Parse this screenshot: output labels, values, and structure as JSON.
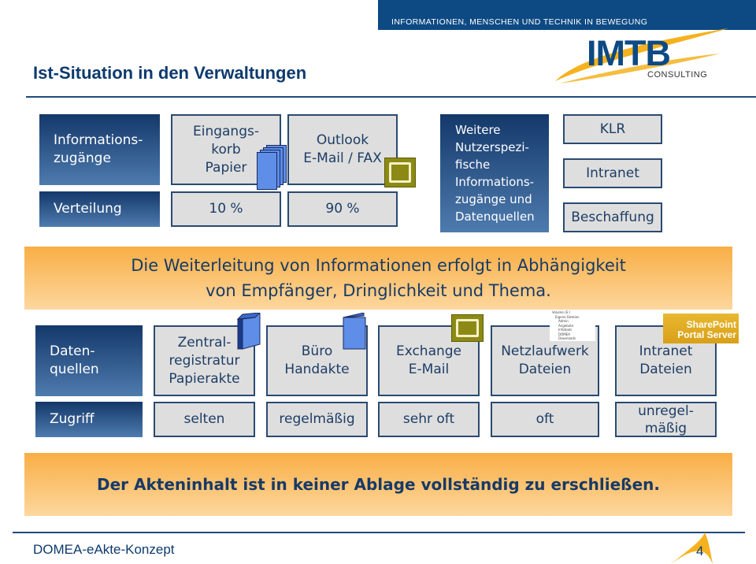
{
  "header": {
    "tagline": "INFORMATIONEN, MENSCHEN UND TECHNIK IN BEWEGUNG",
    "logo_main": "IMTB",
    "logo_sub": "CONSULTING",
    "brand_color": "#0d4a84",
    "accent_color": "#f5b21e"
  },
  "title": "Ist-Situation in den Verwaltungen",
  "top_section": {
    "row_labels": {
      "access": "Informations-\nzugänge",
      "distribution": "Verteilung"
    },
    "sources": [
      {
        "label": "Eingangs-\nkorb\nPapier",
        "share": "10 %",
        "icon": "paper-stack-icon"
      },
      {
        "label": "Outlook\nE-Mail / FAX",
        "share": "90 %",
        "icon": "outlook-mail-icon"
      }
    ],
    "further": "Weitere\nNutzerspezi-\nfische\nInformations-\nzugänge und\nDatenquellen",
    "further_items": [
      "KLR",
      "Intranet",
      "Beschaffung"
    ]
  },
  "banner1": "Die Weiterleitung von Informationen erfolgt in Abhängigkeit\nvon Empfänger, Dringlichkeit und Thema.",
  "bottom_section": {
    "row_labels": {
      "sources": "Daten-\nquellen",
      "access": "Zugriff"
    },
    "columns": [
      {
        "source": "Zentral-\nregistratur\nPapierakte",
        "access": "selten",
        "icon": "binder-icon"
      },
      {
        "source": "Büro\nHandakte",
        "access": "regelmäßig",
        "icon": "folder-icon"
      },
      {
        "source": "Exchange\nE-Mail",
        "access": "sehr oft",
        "icon": "outlook-mail-icon"
      },
      {
        "source": "Netzlaufwerk\nDateien",
        "access": "oft",
        "icon": "file-tree-icon"
      },
      {
        "source": "Intranet\nDateien",
        "access": "unregel-\nmäßig",
        "icon": "sharepoint-icon"
      }
    ],
    "sharepoint_label": "SharePoint\nPortal Server",
    "tree_items": [
      "Volume (E:)",
      "Eigene Dateien",
      "Admin",
      "Angebote",
      "Infotools",
      "DOMEA",
      "Downloads"
    ]
  },
  "banner2": "Der Akteninhalt ist in keiner Ablage vollständig zu erschließen.",
  "footer": {
    "text": "DOMEA-eAkte-Konzept",
    "page": "4"
  }
}
